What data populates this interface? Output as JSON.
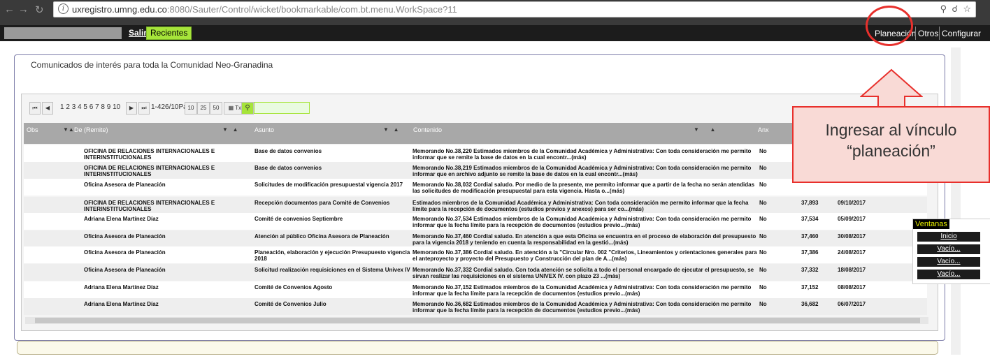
{
  "browser": {
    "url_host": "uxregistro.umng.edu.co",
    "url_rest": ":8080/Sauter/Control/wicket/bookmarkable/com.bt.menu.WorkSpace?11"
  },
  "appbar": {
    "salir": "Salir",
    "recientes": "Recientes",
    "menu": [
      "Planeación",
      "Otros",
      "Configurar"
    ]
  },
  "panel": {
    "title": "Comunicados de interés para toda la Comunidad Neo-Granadina"
  },
  "pager": {
    "pages": [
      "1",
      "2",
      "3",
      "4",
      "5",
      "6",
      "7",
      "8",
      "9",
      "10"
    ],
    "info": "1-426/10Pág",
    "sizes": [
      "10",
      "25",
      "50"
    ],
    "txt": "Txt"
  },
  "table": {
    "headers": [
      "Obs",
      "De (Remite)",
      "Asunto",
      "Contenido",
      "Anx"
    ],
    "rows": [
      {
        "de": "OFICINA DE RELACIONES INTERNACIONALES E INTERINSTITUCIONALES",
        "asunto": "Base de datos convenios",
        "contenido": "Memorando No.38,220 Estimados miembros de la Comunidad Académica y Administrativa: Con toda consideración me permito informar que se remite la base de datos en la cual encontr...(más)",
        "anx": "No",
        "num": "",
        "fecha": ""
      },
      {
        "de": "OFICINA DE RELACIONES INTERNACIONALES E INTERINSTITUCIONALES",
        "asunto": "Base de datos convenios",
        "contenido": "Memorando No.38,219 Estimados miembros de la Comunidad Académica y Administrativa: Con toda consideración me permito informar que en archivo adjunto se remite la base de datos en la cual encontr...(más)",
        "anx": "No",
        "num": "",
        "fecha": ""
      },
      {
        "de": "Oficina Asesora de Planeación",
        "asunto": "Solicitudes de modificación presupuestal vigencia 2017",
        "contenido": "Memorando No.38,032 Cordial saludo. Por medio de la presente, me permito informar que a partir de la fecha no serán atendidas las solicitudes de modificación presupuestal para esta vigencia. Hasta o...(más)",
        "anx": "No",
        "num": "",
        "fecha": ""
      },
      {
        "de": "OFICINA DE RELACIONES INTERNACIONALES E INTERINSTITUCIONALES",
        "asunto": "Recepción documentos para Comité de Convenios",
        "contenido": "Estimados miembros de la Comunidad Académica y Administrativa: Con toda consideración me permito informar que la fecha límite para la recepción de documentos (estudios previos y anexos) para ser co...(más)",
        "anx": "No",
        "num": "37,893",
        "fecha": "09/10/2017"
      },
      {
        "de": "Adriana Elena Martínez Díaz",
        "asunto": "Comité de convenios Septiembre",
        "contenido": "Memorando No.37,534 Estimados miembros de la Comunidad Académica y Administrativa: Con toda consideración me permito informar que la fecha límite para la recepción de documentos (estudios previo...(más)",
        "anx": "No",
        "num": "37,534",
        "fecha": "05/09/2017"
      },
      {
        "de": "Oficina Asesora de Planeación",
        "asunto": "Atención al público Oficina Asesora de Planeación",
        "contenido": "Memorando No.37,460 Cordial saludo. En atención a que esta Oficina se encuentra en el proceso de elaboración del presupuesto para la vigencia 2018 y teniendo en cuenta la responsabilidad en la gestió...(más)",
        "anx": "No",
        "num": "37,460",
        "fecha": "30/08/2017"
      },
      {
        "de": "Oficina Asesora de Planeación",
        "asunto": "Planeación, elaboración y ejecución Presupuesto vigencia 2018",
        "contenido": "Memorando No.37,386 Cordial saludo. En atención a la \"Circular Nro. 002 \"Criterios, Lineamientos y orientaciones generales para el anteproyecto y proyecto del Presupuesto y Construcción del plan de A...(más)",
        "anx": "No",
        "num": "37,386",
        "fecha": "24/08/2017"
      },
      {
        "de": "Oficina Asesora de Planeación",
        "asunto": "Solicitud realización requisiciones en el Sistema Univex IV",
        "contenido": "Memorando No.37,332 Cordial saludo. Con toda atención se solicita a todo el personal encargado de ejecutar el presupuesto, se sirvan realizar las requisiciones en el sistema UNIVEX IV. con plazo 23 ...(más)",
        "anx": "No",
        "num": "37,332",
        "fecha": "18/08/2017"
      },
      {
        "de": "Adriana Elena Martínez Díaz",
        "asunto": "Comité de Convenios Agosto",
        "contenido": "Memorando No.37,152 Estimados miembros de la Comunidad Académica y Administrativa: Con toda consideración me permito informar que la fecha límite para la recepción de documentos (estudios previo...(más)",
        "anx": "No",
        "num": "37,152",
        "fecha": "08/08/2017"
      },
      {
        "de": "Adriana Elena Martínez Díaz",
        "asunto": "Comité de Convenios Julio",
        "contenido": "Memorando No.36,682 Estimados miembros de la Comunidad Académica y Administrativa: Con toda consideración me permito informar que la fecha límite para la recepción de documentos (estudios previo...(más)",
        "anx": "No",
        "num": "36,682",
        "fecha": "06/07/2017"
      }
    ]
  },
  "ventanas": {
    "title": "Ventanas",
    "items": [
      "Inicio",
      "Vacío...",
      "Vacío...",
      "Vacío..."
    ]
  },
  "callout": {
    "line1": "Ingresar al vínculo",
    "line2": "“planeación”"
  },
  "colors": {
    "accent_green": "#a6e43a",
    "annotation_red": "#e8302c",
    "callout_fill": "#f9dad6"
  }
}
